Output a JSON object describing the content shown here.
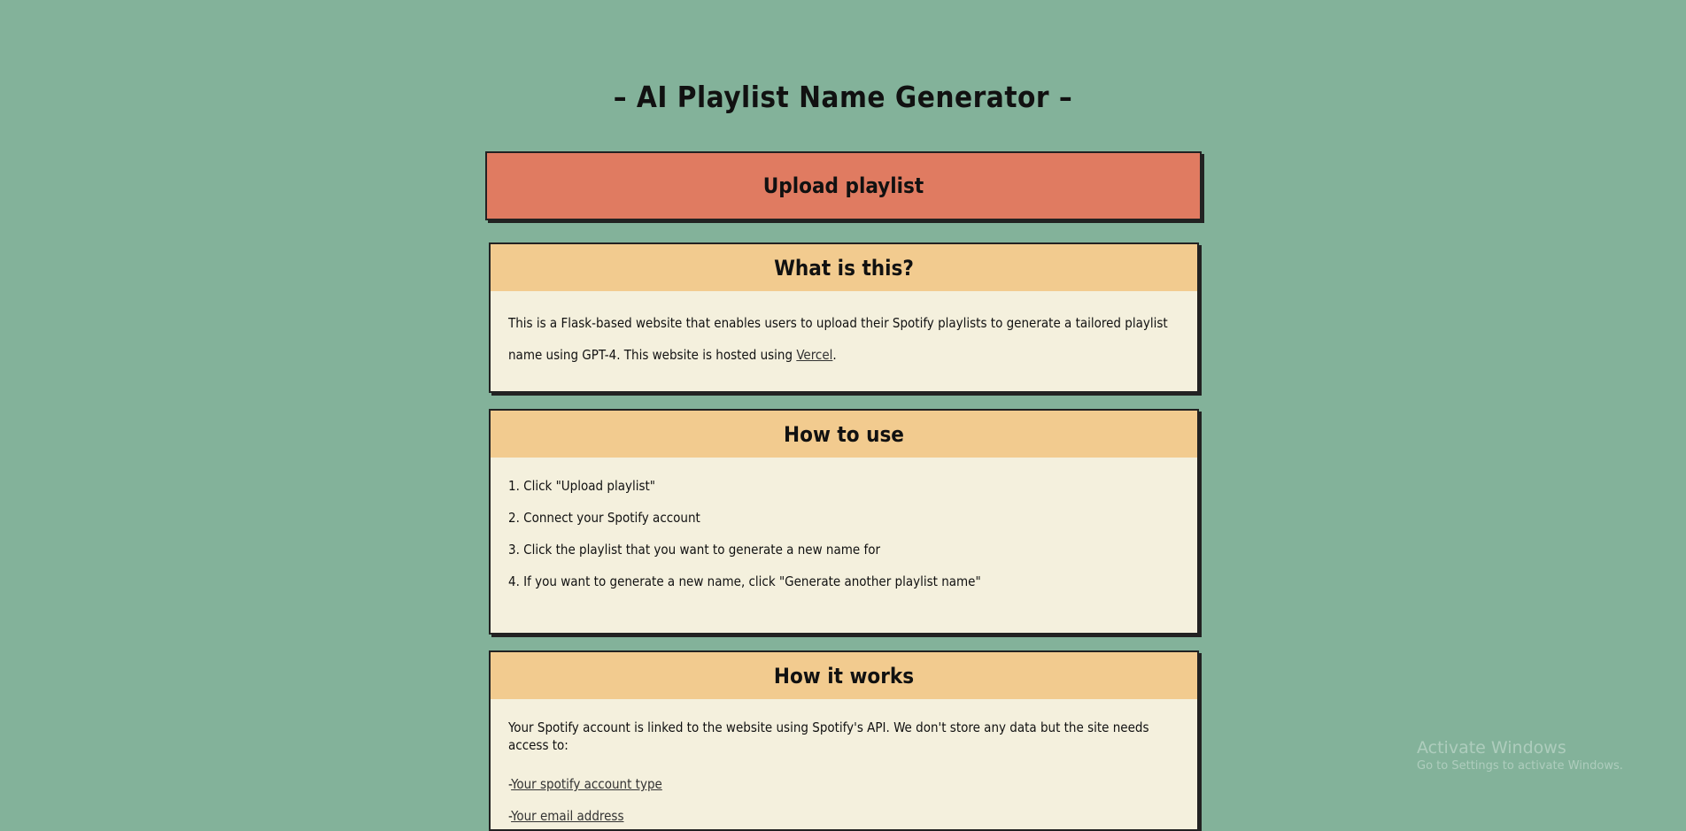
{
  "page": {
    "title": "– AI Playlist Name Generator –"
  },
  "upload": {
    "label": "Upload playlist"
  },
  "what": {
    "heading": "What is this?",
    "text_before": "This is a Flask-based website that enables users to upload their Spotify playlists to generate a tailored playlist name using GPT-4. This website is hosted using ",
    "link": "Vercel",
    "text_after": "."
  },
  "how": {
    "heading": "How to use",
    "steps": [
      "1. Click \"Upload playlist\"",
      "2. Connect your Spotify account",
      "3. Click the playlist that you want to generate a new name for",
      "4. If you want to generate a new name, click \"Generate another playlist name\""
    ]
  },
  "works": {
    "heading": "How it works",
    "intro": "Your Spotify account is linked to the website using Spotify's API. We don't store any data but the site needs access to:",
    "access": [
      {
        "prefix": "-",
        "link": "Your spotify account type"
      },
      {
        "prefix": "-",
        "link": "Your email address"
      }
    ]
  },
  "watermark": {
    "title": "Activate Windows",
    "subtitle": "Go to Settings to activate Windows."
  },
  "colors": {
    "background": "#83b29a",
    "upload_button": "#e07b61",
    "card_header": "#f2cb8f",
    "card_body": "#f4f0dd"
  }
}
